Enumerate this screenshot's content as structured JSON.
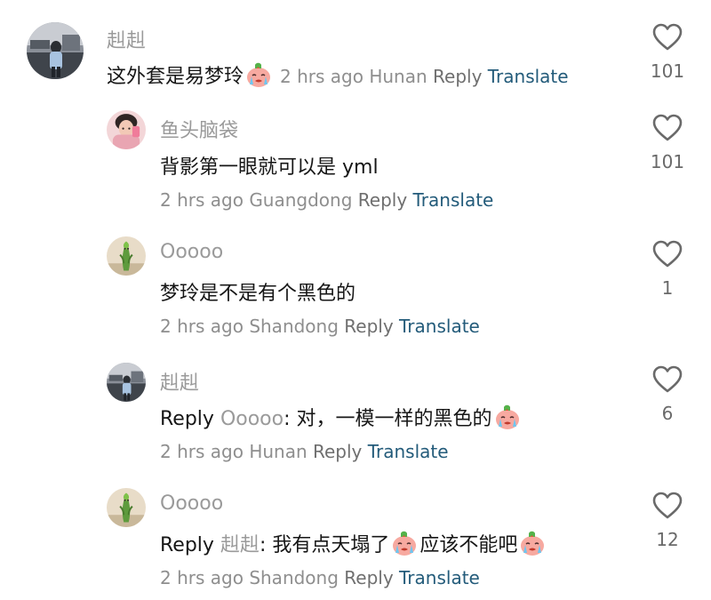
{
  "comments": [
    {
      "username": "赳赳",
      "text": "这外套是易梦玲",
      "text_emoji": "crying-face-emoji",
      "time": "2 hrs ago",
      "location": "Hunan",
      "reply_label": "Reply",
      "translate_label": "Translate",
      "likes": "101"
    },
    {
      "username": "鱼头脑袋",
      "text": "背影第一眼就可以是 yml",
      "time": "2 hrs ago",
      "location": "Guangdong",
      "reply_label": "Reply",
      "translate_label": "Translate",
      "likes": "101"
    },
    {
      "username": "Ooooo",
      "text": "梦玲是不是有个黑色的",
      "time": "2 hrs ago",
      "location": "Shandong",
      "reply_label": "Reply",
      "translate_label": "Translate",
      "likes": "1"
    },
    {
      "username": "赳赳",
      "reply_prefix": "Reply",
      "reply_to": "Ooooo",
      "text": ": 对，一模一样的黑色的",
      "text_emoji": "crying-face-emoji",
      "time": "2 hrs ago",
      "location": "Hunan",
      "reply_label": "Reply",
      "translate_label": "Translate",
      "likes": "6"
    },
    {
      "username": "Ooooo",
      "reply_prefix": "Reply",
      "reply_to": "赳赳",
      "text_part1": ": 我有点天塌了",
      "text_part2": "应该不能吧",
      "text_emoji": "crying-face-emoji",
      "time": "2 hrs ago",
      "location": "Shandong",
      "reply_label": "Reply",
      "translate_label": "Translate",
      "likes": "12"
    }
  ],
  "colors": {
    "username": "#9a9a9a",
    "text": "#161616",
    "meta": "#8e8e8e",
    "translate": "#235b7a",
    "like_icon": "#6a6a6a"
  },
  "icons": {
    "like": "heart-outline-icon"
  }
}
